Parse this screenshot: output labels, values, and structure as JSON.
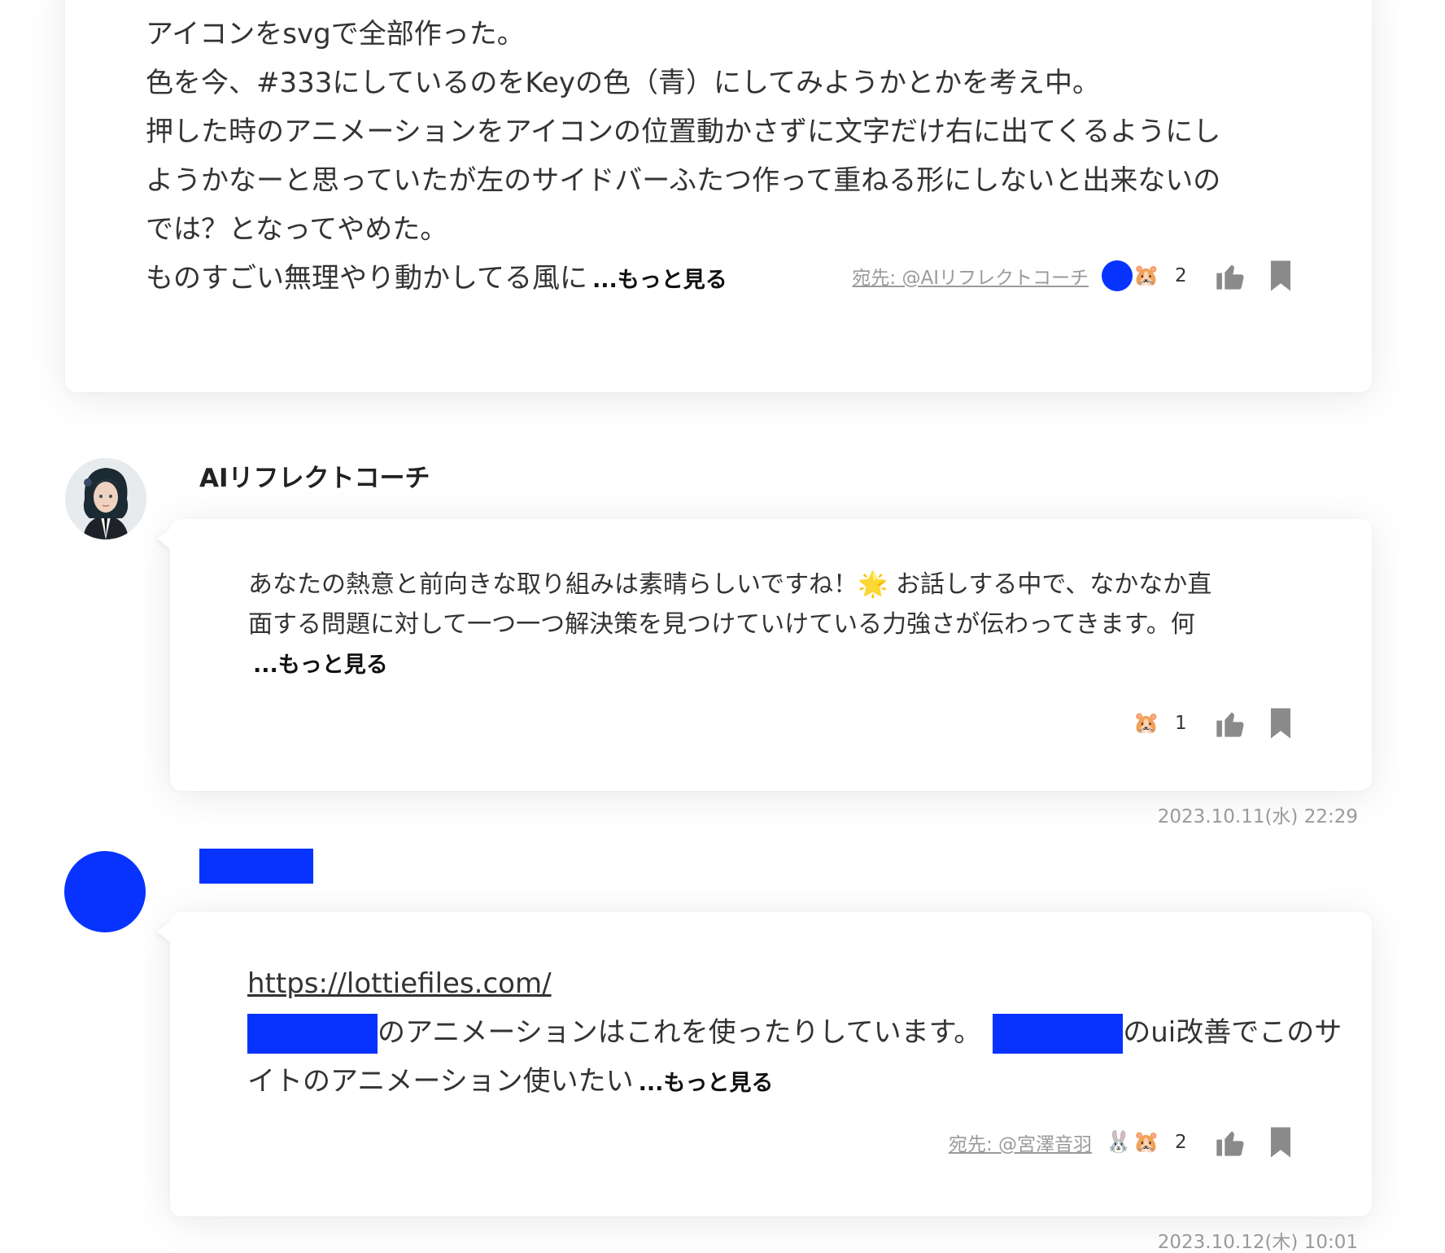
{
  "post1": {
    "lines": [
      "アイコンをsvgで全部作った。",
      "色を今、#333にしているのをKeyの色（青）にしてみようかとかを考え中。",
      "押した時のアニメーションをアイコンの位置動かさずに文字だけ右に出てくるようにし",
      "ようかなーと思っていたが左のサイドバーふたつ作って重ねる形にしないと出来ないの",
      "では？となってやめた。",
      "ものすごい無理やり動かしてる風に"
    ],
    "more_label": "...もっと見る",
    "to_label": "宛先: @AIリフレクトコーチ",
    "reaction_emoji": "🐹",
    "reaction_count": "2"
  },
  "post2": {
    "username": "AIリフレクトコーチ",
    "lines": [
      "あなたの熱意と前向きな取り組みは素晴らしいですね！🌟 お話しする中で、なかなか直",
      "面する問題に対して一つ一つ解決策を見つけていけている力強さが伝わってきます。何"
    ],
    "more_label": "...もっと見る",
    "reaction_emoji": "🐹",
    "reaction_count": "1",
    "timestamp": "2023.10.11(水) 22:29"
  },
  "post3": {
    "link": "https://lottiefiles.com/",
    "line2_a": "のアニメーションはこれを使ったりしています。",
    "line2_b": "のui改善でこのサ",
    "line3": "イトのアニメーション使いたい",
    "more_label": "...もっと見る",
    "to_label": "宛先: @宮澤音羽",
    "reaction_emoji_1": "🐰",
    "reaction_emoji_2": "🐹",
    "reaction_count": "2",
    "timestamp": "2023.10.12(木) 10:01"
  },
  "colors": {
    "accent_blue": "#0833ff",
    "text": "#333333",
    "muted": "#9a9a9a",
    "icon_gray": "#8a8a8a"
  },
  "icons": {
    "like": "thumbs-up-icon",
    "bookmark": "bookmark-icon"
  }
}
